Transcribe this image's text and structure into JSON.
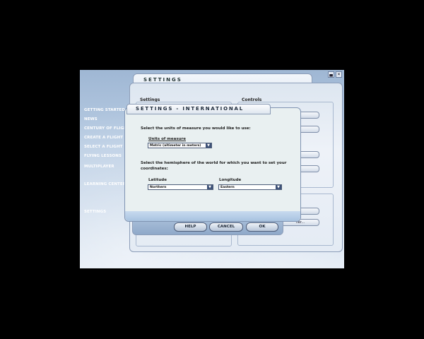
{
  "window": {
    "minimize_label": "▄",
    "close_label": "✕"
  },
  "sidebar": {
    "items": [
      {
        "label": "GETTING STARTED"
      },
      {
        "label": "NEWS"
      },
      {
        "label": "CENTURY OF FLIGHT"
      },
      {
        "label": "CREATE A FLIGHT"
      },
      {
        "label": "SELECT A FLIGHT"
      },
      {
        "label": "FLYING LESSONS"
      },
      {
        "label": "MULTIPLAYER"
      },
      {
        "label": "LEARNING CENTER"
      },
      {
        "label": "SETTINGS"
      }
    ]
  },
  "settings_panel": {
    "title": "SETTINGS",
    "settings_label": "Settings",
    "controls_label": "Controls",
    "partial_button_label": "her..."
  },
  "international_dialog": {
    "title": "SETTINGS - INTERNATIONAL",
    "units_prompt": "Select the units of measure you would like to use:",
    "units_label": "Units of measure",
    "units_value": "Metric (altimeter in meters)",
    "hemisphere_prompt_line1": "Select the hemisphere of the world for which you want to set your",
    "hemisphere_prompt_line2": "coordinates:",
    "latitude_label": "Latitude",
    "latitude_value": "Northern",
    "longitude_label": "Longitude",
    "longitude_value": "Eastern"
  },
  "buttons": {
    "help": "HELP",
    "cancel": "CANCEL",
    "ok": "OK"
  }
}
